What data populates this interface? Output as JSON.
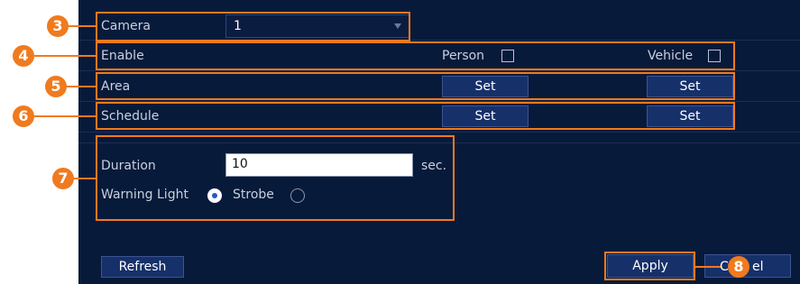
{
  "form": {
    "camera": {
      "label": "Camera",
      "value": "1"
    },
    "enable": {
      "label": "Enable",
      "person_label": "Person",
      "vehicle_label": "Vehicle",
      "person_checked": false,
      "vehicle_checked": false
    },
    "area": {
      "label": "Area",
      "set_label": "Set"
    },
    "schedule": {
      "label": "Schedule",
      "set_label": "Set"
    },
    "duration": {
      "label": "Duration",
      "value": "10",
      "unit": "sec."
    },
    "warning_light": {
      "label": "Warning Light",
      "selected": "",
      "strobe_label": "Strobe"
    }
  },
  "buttons": {
    "refresh": "Refresh",
    "apply": "Apply",
    "cancel_visible": "C",
    "cancel_tail": "el"
  },
  "callouts": [
    "3",
    "4",
    "5",
    "6",
    "7",
    "8"
  ],
  "colors": {
    "panel": "#081a3a",
    "highlight": "#f07a1e",
    "button": "#16306a",
    "text": "#c8d0de"
  }
}
